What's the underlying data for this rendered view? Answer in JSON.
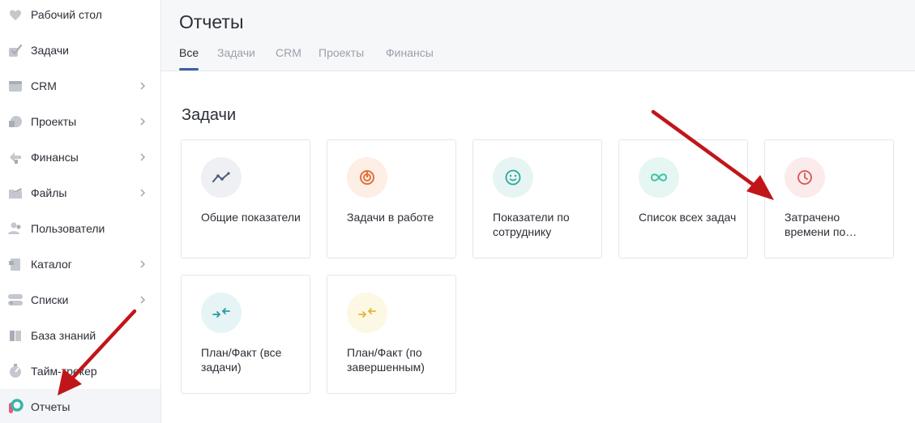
{
  "sidebar": {
    "items": [
      {
        "label": "Рабочий стол",
        "icon": "dashboard-icon",
        "has_submenu": false
      },
      {
        "label": "Задачи",
        "icon": "tasks-icon",
        "has_submenu": false
      },
      {
        "label": "CRM",
        "icon": "crm-icon",
        "has_submenu": true
      },
      {
        "label": "Проекты",
        "icon": "projects-icon",
        "has_submenu": true
      },
      {
        "label": "Финансы",
        "icon": "finance-icon",
        "has_submenu": true
      },
      {
        "label": "Файлы",
        "icon": "files-icon",
        "has_submenu": true
      },
      {
        "label": "Пользователи",
        "icon": "users-icon",
        "has_submenu": false
      },
      {
        "label": "Каталог",
        "icon": "catalog-icon",
        "has_submenu": true
      },
      {
        "label": "Списки",
        "icon": "lists-icon",
        "has_submenu": true
      },
      {
        "label": "База знаний",
        "icon": "knowledge-base-icon",
        "has_submenu": false
      },
      {
        "label": "Тайм-трекер",
        "icon": "time-tracker-icon",
        "has_submenu": false
      },
      {
        "label": "Отчеты",
        "icon": "reports-icon",
        "has_submenu": false,
        "active": true
      }
    ]
  },
  "header": {
    "title": "Отчеты",
    "tabs": [
      {
        "label": "Все",
        "active": true
      },
      {
        "label": "Задачи"
      },
      {
        "label": "CRM"
      },
      {
        "label": "Проекты"
      },
      {
        "label": "Финансы"
      }
    ]
  },
  "main": {
    "section_title": "Задачи",
    "cards": [
      {
        "label": "Общие показатели",
        "icon": "trend-line-icon",
        "color": "#4a5a78",
        "bg": "#eef0f4"
      },
      {
        "label": "Задачи в работе",
        "icon": "target-icon",
        "color": "#e0703a",
        "bg": "#fdeee6"
      },
      {
        "label": "Показатели по сотруднику",
        "icon": "smile-icon",
        "color": "#2aa79b",
        "bg": "#e6f5f3"
      },
      {
        "label": "Список всех задач",
        "icon": "infinity-icon",
        "color": "#3cc3a8",
        "bg": "#e6f7f3"
      },
      {
        "label": "Затрачено времени по…",
        "icon": "clock-icon",
        "color": "#d95454",
        "bg": "#fcebeb"
      },
      {
        "label": "План/Факт (все задачи)",
        "icon": "swap-arrows-icon",
        "color": "#2a9aa3",
        "bg": "#e6f4f5"
      },
      {
        "label": "План/Факт (по завершенным)",
        "icon": "swap-arrows-icon",
        "color": "#e0b53a",
        "bg": "#fdf8e3"
      }
    ]
  },
  "colors": {
    "accent": "#3d5fa8",
    "annotation_arrow": "#c0161a"
  }
}
